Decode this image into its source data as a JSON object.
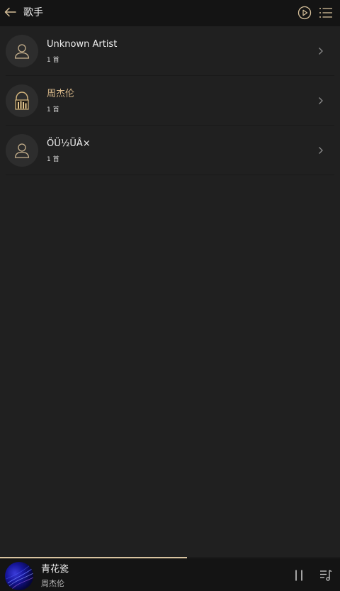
{
  "header": {
    "title": "歌手",
    "back_icon": "arrow-left-icon",
    "play_all_icon": "play-circle-icon",
    "menu_icon": "list-menu-icon"
  },
  "artists": [
    {
      "name": "Unknown Artist",
      "count": "1 首",
      "avatar_icon": "person-icon",
      "highlighted": false
    },
    {
      "name": "周杰伦",
      "count": "1 首",
      "avatar_icon": "artist-portrait-icon",
      "highlighted": true
    },
    {
      "name": "ÖÜ½ÜÂ×",
      "count": "1 首",
      "avatar_icon": "person-icon",
      "highlighted": false
    }
  ],
  "now_playing": {
    "title": "青花瓷",
    "artist": "周杰伦",
    "progress": 0.55,
    "pause_icon": "pause-icon",
    "queue_icon": "playlist-icon"
  },
  "colors": {
    "background": "#202020",
    "header_bg": "#141414",
    "accent_gold": "#d9b98a",
    "text_primary": "#f0f0f0"
  }
}
